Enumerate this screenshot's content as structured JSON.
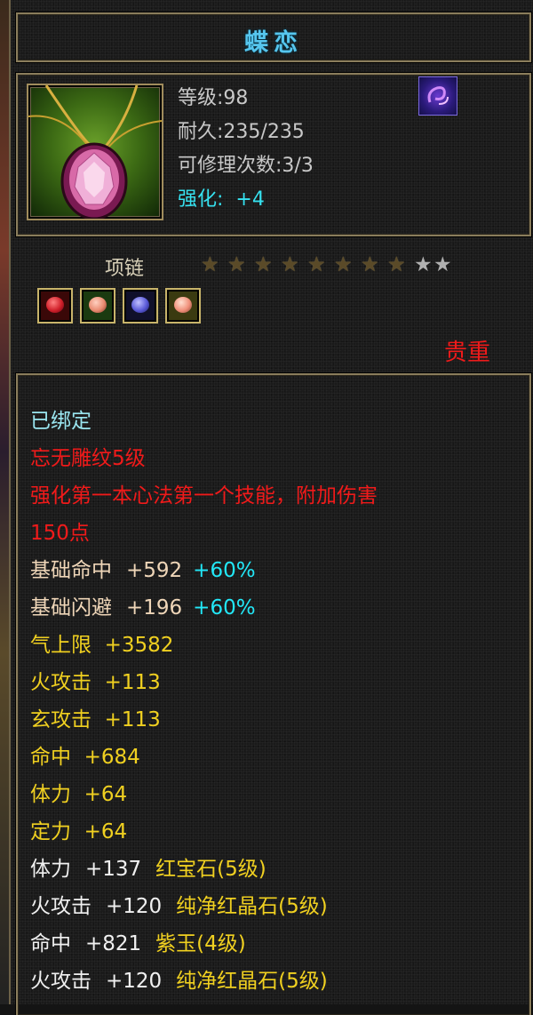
{
  "item": {
    "name": "蝶恋",
    "level_text": "等级:98",
    "durability_text": "耐久:235/235",
    "repair_text": "可修理次数:3/3",
    "enhance_label": "强化:",
    "enhance_value": "+4",
    "type": "项链",
    "stars": {
      "filled": 8,
      "total": 10
    },
    "rarity": "贵重",
    "icons": [
      "necklace-icon",
      "emblem-icon"
    ],
    "gem_sockets": [
      {
        "name": "red-gem-icon",
        "color": "#d0202a"
      },
      {
        "name": "pink-green-gem-icon",
        "color": "#e88a70"
      },
      {
        "name": "blue-gem-icon",
        "color": "#5a5ad8"
      },
      {
        "name": "pink-gem-icon",
        "color": "#f0907a"
      }
    ]
  },
  "attributes": {
    "bound": "已绑定",
    "effect_1": "忘无雕纹5级",
    "effect_2": "强化第一本心法第一个技能，附加伤害",
    "effect_3": "150点",
    "hit_base_label": "基础命中",
    "hit_base_value": "+592",
    "hit_base_pct": "+60%",
    "dodge_base_label": "基础闪避",
    "dodge_base_value": "+196",
    "dodge_base_pct": "+60%",
    "qi": "气上限  +3582",
    "fire": "火攻击  +113",
    "xuan": "玄攻击  +113",
    "hit": "命中  +684",
    "stamina": "体力  +64",
    "focus": "定力  +64",
    "gem_lines": [
      {
        "label": "体力",
        "value": "+137",
        "gem": "红宝石(5级)"
      },
      {
        "label": "火攻击",
        "value": "+120",
        "gem": "纯净红晶石(5级)"
      },
      {
        "label": "命中",
        "value": "+821",
        "gem": "紫玉(4级)"
      },
      {
        "label": "火攻击",
        "value": "+120",
        "gem": "纯净红晶石(5级)"
      }
    ]
  },
  "colors": {
    "title": "#56c6ee",
    "enhance": "#36e2f0",
    "rarity": "#f01a1a",
    "effect": "#f01a1a",
    "base_stat": "#efd6b8",
    "stat": "#f0d020",
    "gem_stat": "#f0f0f0"
  }
}
